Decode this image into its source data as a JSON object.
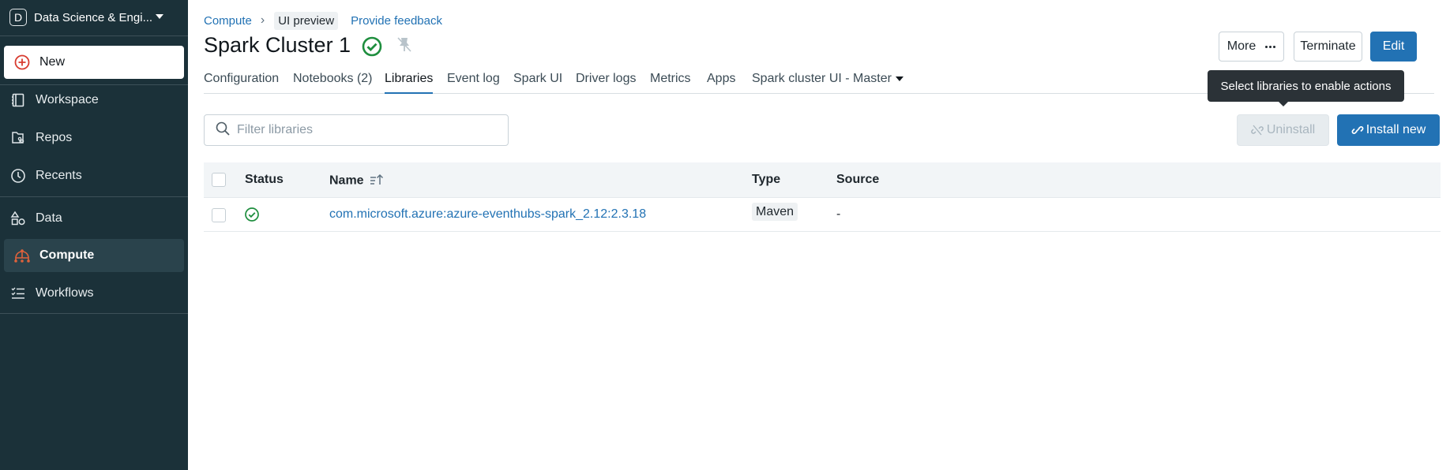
{
  "sidebar": {
    "workspace_initial": "D",
    "workspace_name": "Data Science & Engi...",
    "items": [
      {
        "label": "New",
        "icon": "plus-circle-icon"
      },
      {
        "label": "Workspace",
        "icon": "workspace-icon"
      },
      {
        "label": "Repos",
        "icon": "repos-icon"
      },
      {
        "label": "Recents",
        "icon": "clock-icon"
      },
      {
        "label": "Data",
        "icon": "data-icon"
      },
      {
        "label": "Compute",
        "icon": "compute-icon"
      },
      {
        "label": "Workflows",
        "icon": "workflows-icon"
      }
    ]
  },
  "breadcrumb": {
    "parent": "Compute",
    "preview_label": "UI preview",
    "feedback_label": "Provide feedback"
  },
  "page": {
    "title": "Spark Cluster 1",
    "status": "running"
  },
  "actions": {
    "more_label": "More",
    "terminate_label": "Terminate",
    "edit_label": "Edit"
  },
  "tabs": [
    {
      "label": "Configuration",
      "active": false
    },
    {
      "label": "Notebooks (2)",
      "active": false
    },
    {
      "label": "Libraries",
      "active": true
    },
    {
      "label": "Event log",
      "active": false
    },
    {
      "label": "Spark UI",
      "active": false
    },
    {
      "label": "Driver logs",
      "active": false
    },
    {
      "label": "Metrics",
      "active": false
    },
    {
      "label": "Apps",
      "active": false
    },
    {
      "label": "Spark cluster UI - Master",
      "active": false
    }
  ],
  "tooltip": "Select libraries to enable actions",
  "filter": {
    "placeholder": "Filter libraries",
    "value": ""
  },
  "library_actions": {
    "uninstall_label": "Uninstall",
    "install_label": "Install new"
  },
  "table": {
    "columns": [
      "Status",
      "Name",
      "Type",
      "Source"
    ],
    "rows": [
      {
        "status": "installed",
        "name": "com.microsoft.azure:azure-eventhubs-spark_2.12:2.3.18",
        "type": "Maven",
        "source": "-"
      }
    ]
  },
  "colors": {
    "sidebar_bg": "#1b3139",
    "accent": "#2272b4",
    "success": "#1e8e3e",
    "compute_icon": "#e0623b"
  }
}
